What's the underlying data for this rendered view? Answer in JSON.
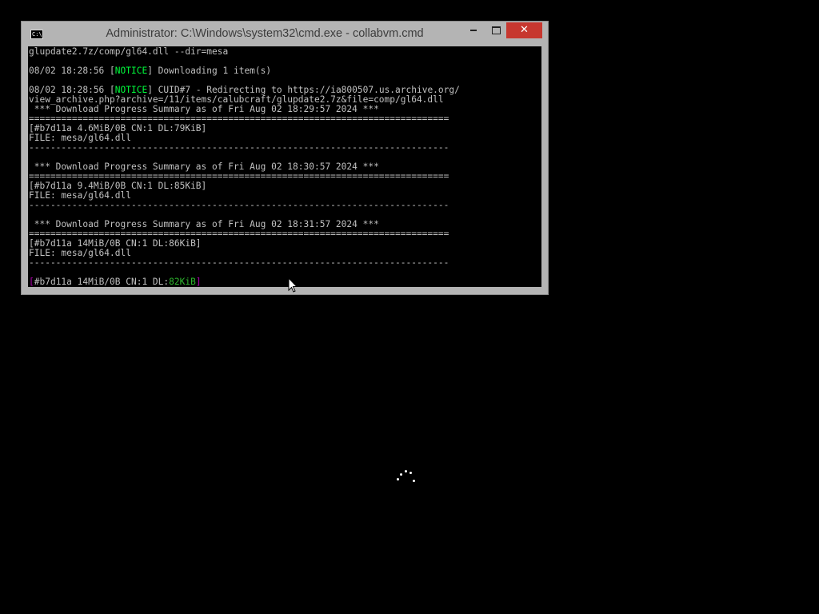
{
  "window": {
    "title": "Administrator: C:\\Windows\\system32\\cmd.exe - collabvm.cmd",
    "icon": "cmd-icon",
    "icon_text": "C:\\",
    "close_glyph": "✕"
  },
  "console": {
    "line1": "glupdate2.7z/comp/gl64.dll --dir=mesa",
    "line2_prefix": "08/02 18:28:56 [",
    "line2_notice": "NOTICE",
    "line2_suffix": "] Downloading 1 item(s)",
    "line3_prefix": "08/02 18:28:56 [",
    "line3_notice": "NOTICE",
    "line3_suffix": "] CUID#7 - Redirecting to https://ia800507.us.archive.org/",
    "line4": "view_archive.php?archive=/11/items/calubcraft/glupdate2.7z&file=comp/gl64.dll",
    "summaries": [
      {
        "header": " *** Download Progress Summary as of Fri Aug 02 18:29:57 2024 ***",
        "status": "[#b7d11a 4.6MiB/0B CN:1 DL:79KiB]",
        "file": "FILE: mesa/gl64.dll"
      },
      {
        "header": " *** Download Progress Summary as of Fri Aug 02 18:30:57 2024 ***",
        "status": "[#b7d11a 9.4MiB/0B CN:1 DL:85KiB]",
        "file": "FILE: mesa/gl64.dll"
      },
      {
        "header": " *** Download Progress Summary as of Fri Aug 02 18:31:57 2024 ***",
        "status": "[#b7d11a 14MiB/0B CN:1 DL:86KiB]",
        "file": "FILE: mesa/gl64.dll"
      }
    ],
    "double_rule": "==============================================================================",
    "single_rule": "------------------------------------------------------------------------------",
    "live_open": "[",
    "live_body": "#b7d11a 14MiB/0B CN:1 DL:",
    "live_speed": "82KiB",
    "live_close": "]"
  },
  "colors": {
    "notice": "#00ff3c",
    "progress_bracket": "#b000b0",
    "progress_speed": "#2eb82e",
    "close_button": "#c7372f"
  }
}
